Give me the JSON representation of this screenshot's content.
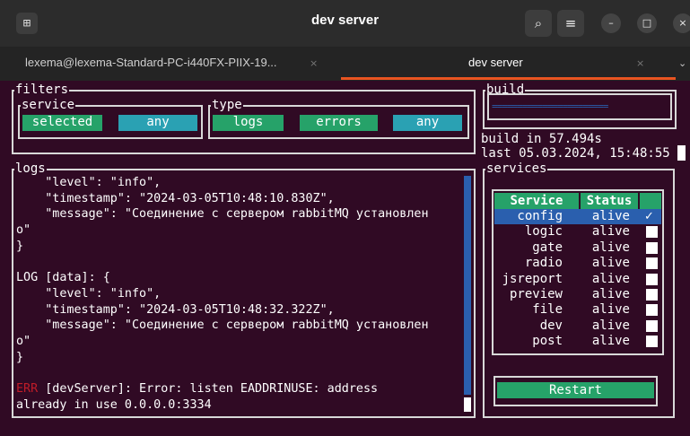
{
  "window": {
    "title": "dev server",
    "new_tab_icon": "terminal-new-tab-icon",
    "search_icon": "⌕",
    "menu_icon": "≡",
    "minimize_icon": "–",
    "maximize_icon": "□",
    "close_icon": "×"
  },
  "tabs": [
    {
      "label": "lexema@lexema-Standard-PC-i440FX-PIIX-19...",
      "close": "×",
      "active": false
    },
    {
      "label": "dev server",
      "close": "×",
      "active": true
    }
  ],
  "tab_overflow_icon": "⌄",
  "filters": {
    "title": "filters",
    "service": {
      "title": "service",
      "options": [
        "selected",
        "any"
      ]
    },
    "type": {
      "title": "type",
      "options": [
        "logs",
        "errors",
        "any"
      ]
    }
  },
  "build": {
    "title": "build",
    "progress_text": "=======================",
    "line1": "build in 57.494s",
    "line2": "last 05.03.2024, 15:48:55"
  },
  "logs": {
    "title": "logs",
    "lines": [
      {
        "text": "    \"level\": \"info\",",
        "err_prefix": ""
      },
      {
        "text": "    \"timestamp\": \"2024-03-05T10:48:10.830Z\",",
        "err_prefix": ""
      },
      {
        "text": "    \"message\": \"Соединение с сервером rabbitMQ установлен",
        "err_prefix": ""
      },
      {
        "text": "о\"",
        "err_prefix": ""
      },
      {
        "text": "}",
        "err_prefix": ""
      },
      {
        "text": "",
        "err_prefix": ""
      },
      {
        "text": "LOG [data]: {",
        "err_prefix": ""
      },
      {
        "text": "    \"level\": \"info\",",
        "err_prefix": ""
      },
      {
        "text": "    \"timestamp\": \"2024-03-05T10:48:32.322Z\",",
        "err_prefix": ""
      },
      {
        "text": "    \"message\": \"Соединение с сервером rabbitMQ установлен",
        "err_prefix": ""
      },
      {
        "text": "о\"",
        "err_prefix": ""
      },
      {
        "text": "}",
        "err_prefix": ""
      },
      {
        "text": "",
        "err_prefix": ""
      },
      {
        "text": " [devServer]: Error: listen EADDRINUSE: address",
        "err_prefix": "ERR"
      },
      {
        "text": "already in use 0.0.0.0:3334",
        "err_prefix": ""
      }
    ]
  },
  "services": {
    "title": "services",
    "col_service": "Service",
    "col_status": "Status",
    "rows": [
      {
        "name": "config",
        "status": "alive",
        "checked": true,
        "tick": "✓"
      },
      {
        "name": "logic",
        "status": "alive",
        "checked": false,
        "tick": ""
      },
      {
        "name": "gate",
        "status": "alive",
        "checked": false,
        "tick": ""
      },
      {
        "name": "radio",
        "status": "alive",
        "checked": false,
        "tick": ""
      },
      {
        "name": "jsreport",
        "status": "alive",
        "checked": false,
        "tick": ""
      },
      {
        "name": "preview",
        "status": "alive",
        "checked": false,
        "tick": ""
      },
      {
        "name": "file",
        "status": "alive",
        "checked": false,
        "tick": ""
      },
      {
        "name": "dev",
        "status": "alive",
        "checked": false,
        "tick": ""
      },
      {
        "name": "post",
        "status": "alive",
        "checked": false,
        "tick": ""
      }
    ],
    "restart_label": "Restart"
  },
  "colors": {
    "background": "#300a24",
    "green": "#26a269",
    "cyan": "#2aa1b3",
    "blue": "#2a5fae",
    "error": "#c01c28",
    "tab_accent": "#e95420"
  }
}
